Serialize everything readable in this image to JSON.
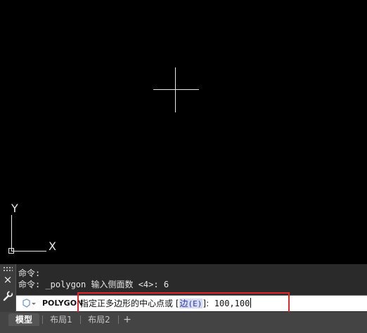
{
  "ucs": {
    "x_label": "X",
    "y_label": "Y"
  },
  "command_line": {
    "close_icon": "×",
    "settings_icon": "wrench-icon",
    "history": [
      "命令:",
      "命令: _polygon 输入侧面数 <4>: 6"
    ],
    "command_name": "POLYGON",
    "prompt_text": "指定正多边形的中心点或 [",
    "option_label": "边",
    "option_key": "(E)",
    "prompt_suffix": "]:  ",
    "input_value": "100,100"
  },
  "tabs": {
    "model": "模型",
    "layout1": "布局1",
    "layout2": "布局2",
    "add": "+"
  },
  "colors": {
    "canvas": "#000000",
    "highlight": "#e2242b",
    "command_bg": "#2a2a2a"
  }
}
